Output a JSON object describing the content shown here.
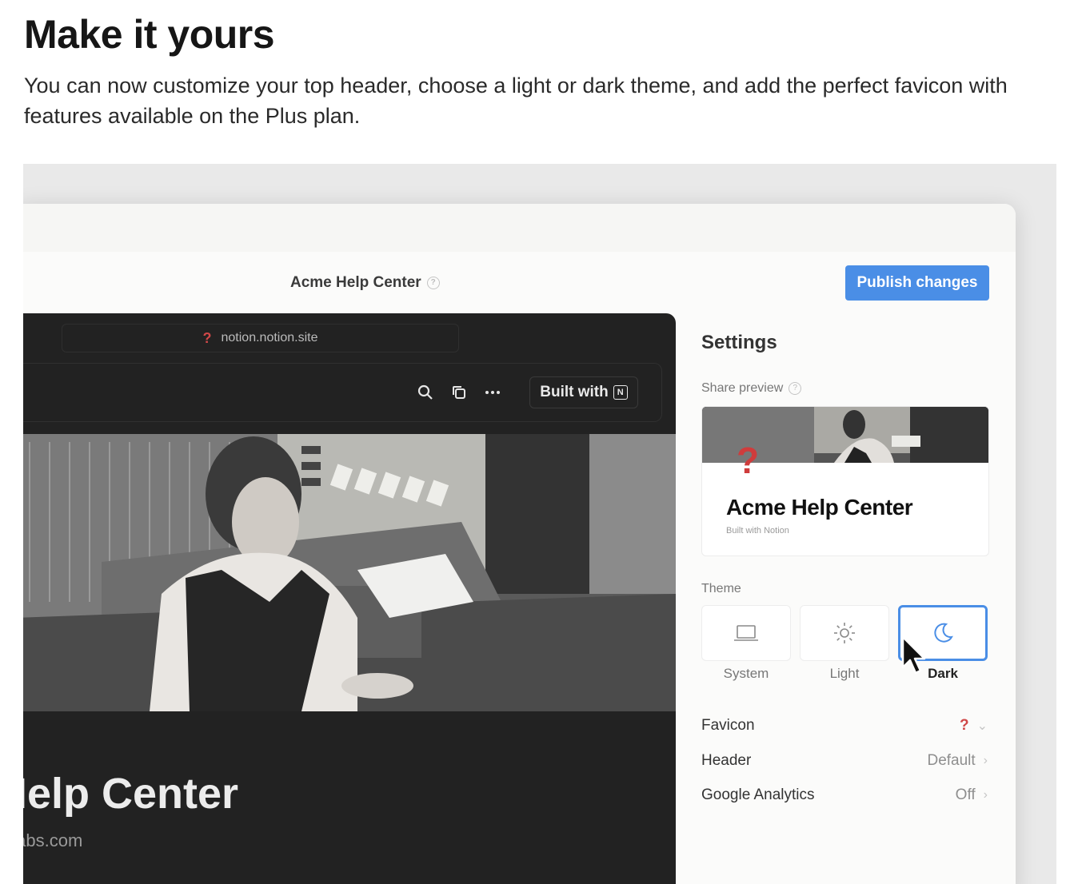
{
  "intro": {
    "title": "Make it yours",
    "body": "You can now customize your top header, choose a light or dark theme, and add the perfect favicon with features available on the Plus plan."
  },
  "app": {
    "site_title": "Acme Help Center",
    "publish_label": "Publish changes",
    "preview": {
      "url": "notion.notion.site",
      "favicon_glyph": "?",
      "built_with_label": "Built with",
      "page_title": "Help Center",
      "page_domain": "elabs.com"
    },
    "settings": {
      "heading": "Settings",
      "share_preview_label": "Share preview",
      "share_card": {
        "title": "Acme Help Center",
        "subtitle": "Built with Notion",
        "favicon_glyph": "?"
      },
      "theme_label": "Theme",
      "themes": [
        {
          "label": "System",
          "icon": "laptop-icon",
          "selected": false
        },
        {
          "label": "Light",
          "icon": "sun-icon",
          "selected": false
        },
        {
          "label": "Dark",
          "icon": "moon-icon",
          "selected": true
        }
      ],
      "rows": [
        {
          "label": "Favicon",
          "value": "?",
          "chevron": "chevron-down-icon"
        },
        {
          "label": "Header",
          "value": "Default",
          "chevron": "chevron-right-icon"
        },
        {
          "label": "Google Analytics",
          "value": "Off",
          "chevron": "chevron-right-icon"
        }
      ]
    }
  },
  "colors": {
    "accent": "#4a8ee6",
    "favicon": "#d04848",
    "preview_bg": "#222222"
  }
}
